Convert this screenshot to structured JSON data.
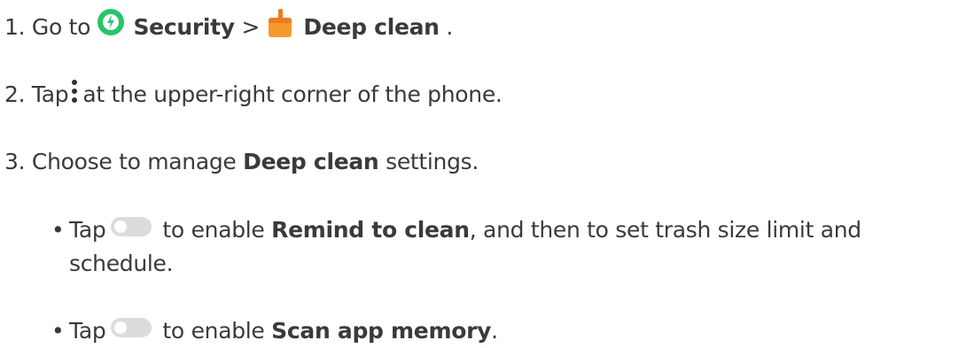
{
  "steps": [
    {
      "number": "1.",
      "pre": "Go to",
      "app1": "Security",
      "separator": ">",
      "app2": "Deep clean",
      "post": "."
    },
    {
      "number": "2.",
      "pre": "Tap",
      "post": "at the upper-right corner of the phone."
    },
    {
      "number": "3.",
      "pre": "Choose to manage",
      "bold": "Deep clean",
      "post": "settings."
    }
  ],
  "bullets": [
    {
      "pre": "Tap",
      "mid": "to enable",
      "bold": "Remind to clean",
      "post_line1": ", and then to set trash size limit and",
      "post_line2": "schedule."
    },
    {
      "pre": "Tap",
      "mid": "to enable",
      "bold": "Scan app memory",
      "post": "."
    }
  ],
  "icons": {
    "security": "security-icon",
    "deep_clean": "deep-clean-icon",
    "more": "more-vertical-icon",
    "toggle": "toggle-switch-icon"
  },
  "colors": {
    "security_green": "#29c46a",
    "clean_orange": "#f59a2c",
    "toggle_grey": "#dcdcdc",
    "text": "#3a3a3a"
  }
}
